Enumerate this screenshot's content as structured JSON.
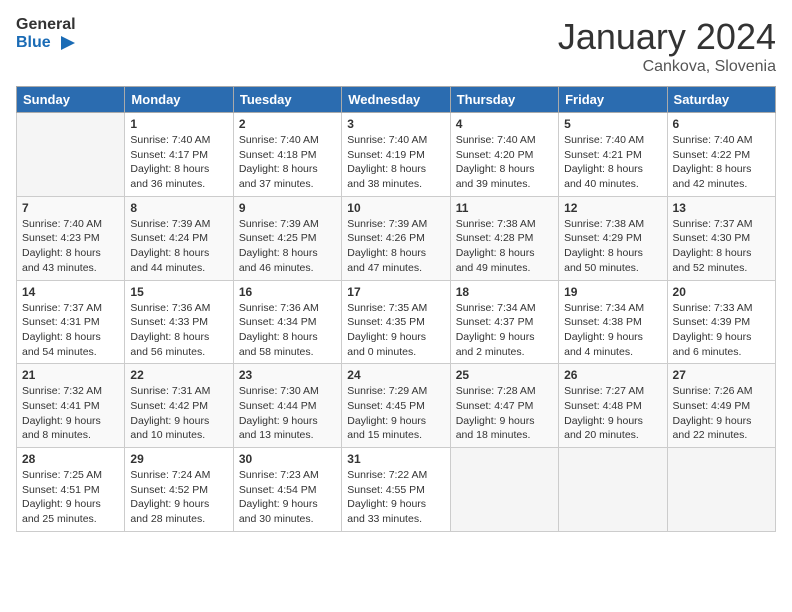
{
  "header": {
    "logo_general": "General",
    "logo_blue": "Blue",
    "month_title": "January 2024",
    "location": "Cankova, Slovenia"
  },
  "weekdays": [
    "Sunday",
    "Monday",
    "Tuesday",
    "Wednesday",
    "Thursday",
    "Friday",
    "Saturday"
  ],
  "weeks": [
    [
      {
        "day": "",
        "sunrise": "",
        "sunset": "",
        "daylight": ""
      },
      {
        "day": "1",
        "sunrise": "Sunrise: 7:40 AM",
        "sunset": "Sunset: 4:17 PM",
        "daylight": "Daylight: 8 hours and 36 minutes."
      },
      {
        "day": "2",
        "sunrise": "Sunrise: 7:40 AM",
        "sunset": "Sunset: 4:18 PM",
        "daylight": "Daylight: 8 hours and 37 minutes."
      },
      {
        "day": "3",
        "sunrise": "Sunrise: 7:40 AM",
        "sunset": "Sunset: 4:19 PM",
        "daylight": "Daylight: 8 hours and 38 minutes."
      },
      {
        "day": "4",
        "sunrise": "Sunrise: 7:40 AM",
        "sunset": "Sunset: 4:20 PM",
        "daylight": "Daylight: 8 hours and 39 minutes."
      },
      {
        "day": "5",
        "sunrise": "Sunrise: 7:40 AM",
        "sunset": "Sunset: 4:21 PM",
        "daylight": "Daylight: 8 hours and 40 minutes."
      },
      {
        "day": "6",
        "sunrise": "Sunrise: 7:40 AM",
        "sunset": "Sunset: 4:22 PM",
        "daylight": "Daylight: 8 hours and 42 minutes."
      }
    ],
    [
      {
        "day": "7",
        "sunrise": "Sunrise: 7:40 AM",
        "sunset": "Sunset: 4:23 PM",
        "daylight": "Daylight: 8 hours and 43 minutes."
      },
      {
        "day": "8",
        "sunrise": "Sunrise: 7:39 AM",
        "sunset": "Sunset: 4:24 PM",
        "daylight": "Daylight: 8 hours and 44 minutes."
      },
      {
        "day": "9",
        "sunrise": "Sunrise: 7:39 AM",
        "sunset": "Sunset: 4:25 PM",
        "daylight": "Daylight: 8 hours and 46 minutes."
      },
      {
        "day": "10",
        "sunrise": "Sunrise: 7:39 AM",
        "sunset": "Sunset: 4:26 PM",
        "daylight": "Daylight: 8 hours and 47 minutes."
      },
      {
        "day": "11",
        "sunrise": "Sunrise: 7:38 AM",
        "sunset": "Sunset: 4:28 PM",
        "daylight": "Daylight: 8 hours and 49 minutes."
      },
      {
        "day": "12",
        "sunrise": "Sunrise: 7:38 AM",
        "sunset": "Sunset: 4:29 PM",
        "daylight": "Daylight: 8 hours and 50 minutes."
      },
      {
        "day": "13",
        "sunrise": "Sunrise: 7:37 AM",
        "sunset": "Sunset: 4:30 PM",
        "daylight": "Daylight: 8 hours and 52 minutes."
      }
    ],
    [
      {
        "day": "14",
        "sunrise": "Sunrise: 7:37 AM",
        "sunset": "Sunset: 4:31 PM",
        "daylight": "Daylight: 8 hours and 54 minutes."
      },
      {
        "day": "15",
        "sunrise": "Sunrise: 7:36 AM",
        "sunset": "Sunset: 4:33 PM",
        "daylight": "Daylight: 8 hours and 56 minutes."
      },
      {
        "day": "16",
        "sunrise": "Sunrise: 7:36 AM",
        "sunset": "Sunset: 4:34 PM",
        "daylight": "Daylight: 8 hours and 58 minutes."
      },
      {
        "day": "17",
        "sunrise": "Sunrise: 7:35 AM",
        "sunset": "Sunset: 4:35 PM",
        "daylight": "Daylight: 9 hours and 0 minutes."
      },
      {
        "day": "18",
        "sunrise": "Sunrise: 7:34 AM",
        "sunset": "Sunset: 4:37 PM",
        "daylight": "Daylight: 9 hours and 2 minutes."
      },
      {
        "day": "19",
        "sunrise": "Sunrise: 7:34 AM",
        "sunset": "Sunset: 4:38 PM",
        "daylight": "Daylight: 9 hours and 4 minutes."
      },
      {
        "day": "20",
        "sunrise": "Sunrise: 7:33 AM",
        "sunset": "Sunset: 4:39 PM",
        "daylight": "Daylight: 9 hours and 6 minutes."
      }
    ],
    [
      {
        "day": "21",
        "sunrise": "Sunrise: 7:32 AM",
        "sunset": "Sunset: 4:41 PM",
        "daylight": "Daylight: 9 hours and 8 minutes."
      },
      {
        "day": "22",
        "sunrise": "Sunrise: 7:31 AM",
        "sunset": "Sunset: 4:42 PM",
        "daylight": "Daylight: 9 hours and 10 minutes."
      },
      {
        "day": "23",
        "sunrise": "Sunrise: 7:30 AM",
        "sunset": "Sunset: 4:44 PM",
        "daylight": "Daylight: 9 hours and 13 minutes."
      },
      {
        "day": "24",
        "sunrise": "Sunrise: 7:29 AM",
        "sunset": "Sunset: 4:45 PM",
        "daylight": "Daylight: 9 hours and 15 minutes."
      },
      {
        "day": "25",
        "sunrise": "Sunrise: 7:28 AM",
        "sunset": "Sunset: 4:47 PM",
        "daylight": "Daylight: 9 hours and 18 minutes."
      },
      {
        "day": "26",
        "sunrise": "Sunrise: 7:27 AM",
        "sunset": "Sunset: 4:48 PM",
        "daylight": "Daylight: 9 hours and 20 minutes."
      },
      {
        "day": "27",
        "sunrise": "Sunrise: 7:26 AM",
        "sunset": "Sunset: 4:49 PM",
        "daylight": "Daylight: 9 hours and 22 minutes."
      }
    ],
    [
      {
        "day": "28",
        "sunrise": "Sunrise: 7:25 AM",
        "sunset": "Sunset: 4:51 PM",
        "daylight": "Daylight: 9 hours and 25 minutes."
      },
      {
        "day": "29",
        "sunrise": "Sunrise: 7:24 AM",
        "sunset": "Sunset: 4:52 PM",
        "daylight": "Daylight: 9 hours and 28 minutes."
      },
      {
        "day": "30",
        "sunrise": "Sunrise: 7:23 AM",
        "sunset": "Sunset: 4:54 PM",
        "daylight": "Daylight: 9 hours and 30 minutes."
      },
      {
        "day": "31",
        "sunrise": "Sunrise: 7:22 AM",
        "sunset": "Sunset: 4:55 PM",
        "daylight": "Daylight: 9 hours and 33 minutes."
      },
      {
        "day": "",
        "sunrise": "",
        "sunset": "",
        "daylight": ""
      },
      {
        "day": "",
        "sunrise": "",
        "sunset": "",
        "daylight": ""
      },
      {
        "day": "",
        "sunrise": "",
        "sunset": "",
        "daylight": ""
      }
    ]
  ]
}
